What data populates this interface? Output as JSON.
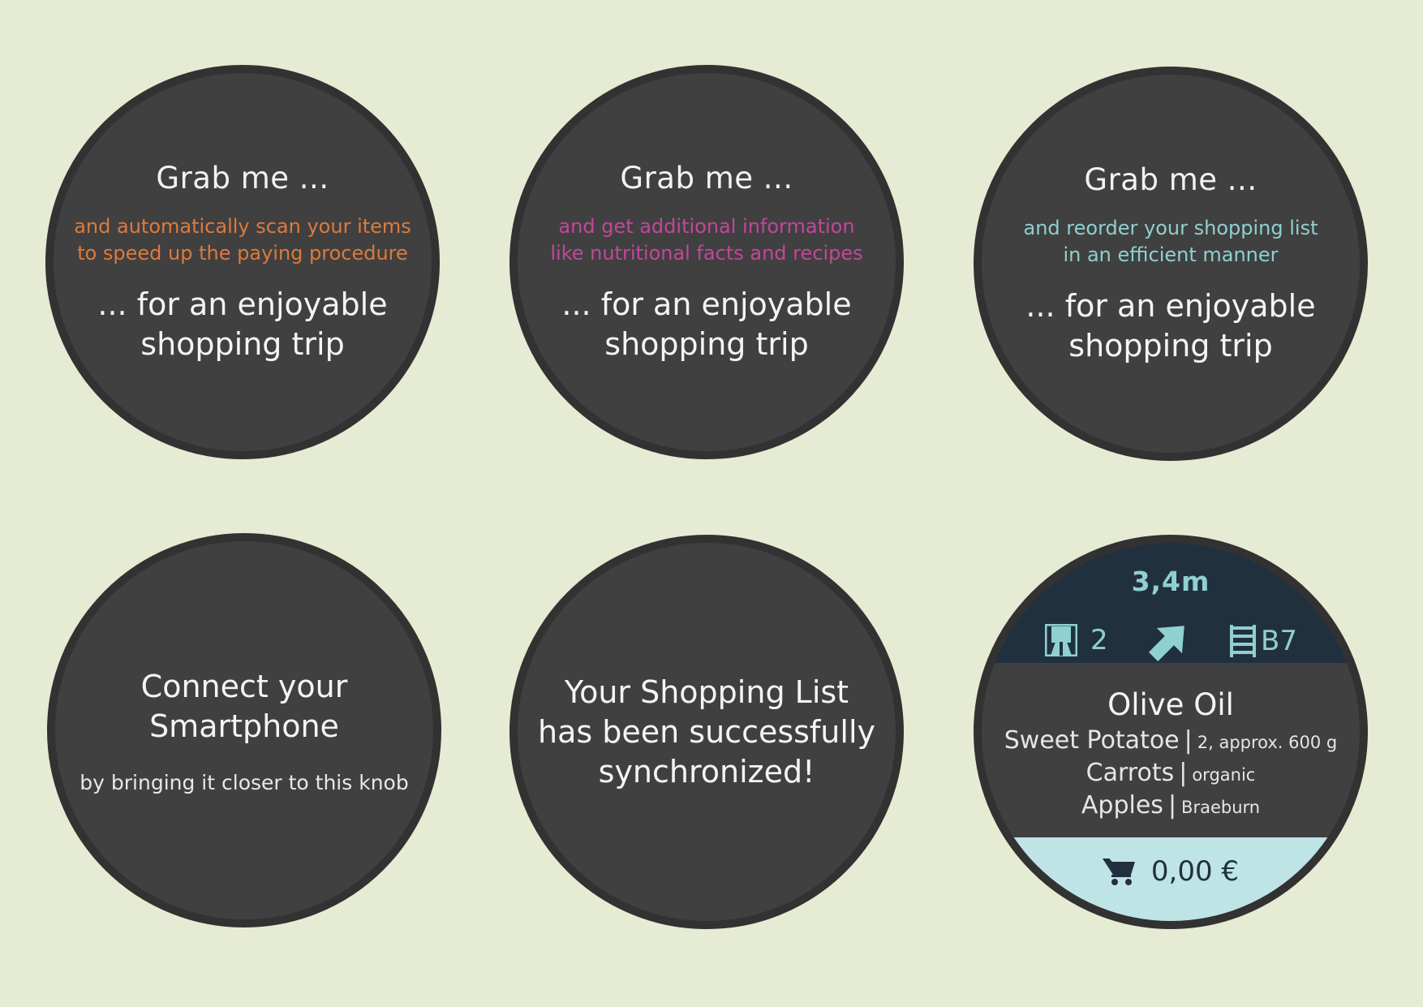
{
  "cards": [
    {
      "title": "Grab me ...",
      "subtitle_line1": "and automatically scan your items",
      "subtitle_line2": "to speed up the paying procedure",
      "tagline_line1": "... for an enjoyable",
      "tagline_line2": "shopping trip",
      "accent": "#dd7a3c"
    },
    {
      "title": "Grab me ...",
      "subtitle_line1": "and get additional information",
      "subtitle_line2": "like nutritional facts and recipes",
      "tagline_line1": "... for an enjoyable",
      "tagline_line2": "shopping trip",
      "accent": "#c2479a"
    },
    {
      "title": "Grab me ...",
      "subtitle_line1": "and reorder your shopping list",
      "subtitle_line2": "in an efficient manner",
      "tagline_line1": "... for an enjoyable",
      "tagline_line2": "shopping trip",
      "accent": "#8fd0d0"
    }
  ],
  "connect": {
    "title_line1": "Connect your",
    "title_line2": "Smartphone",
    "subtitle": "by bringing it closer to this knob"
  },
  "sync": {
    "line1": "Your Shopping List",
    "line2": "has been successfully",
    "line3": "synchronized!"
  },
  "navigation": {
    "distance": "3,4m",
    "aisle_number": "2",
    "shelf_code": "B7",
    "aisle_icon": "aisle-icon",
    "direction_icon": "arrow-up-right-icon",
    "shelf_icon": "shelf-icon",
    "current_item": "Olive Oil",
    "list": [
      {
        "name": "Sweet Potatoe",
        "separator": "|",
        "detail": "2, approx. 600 g"
      },
      {
        "name": "Carrots",
        "separator": "|",
        "detail": "organic"
      },
      {
        "name": "Apples",
        "separator": "|",
        "detail": "Braeburn"
      }
    ],
    "cart_total": "0,00 €",
    "cart_icon": "cart-icon"
  },
  "colors": {
    "background": "#e6ebd3",
    "knob": "#404040",
    "knob_rim": "#323232",
    "nav_header": "#21303f",
    "accent_teal": "#8fd0d0",
    "cart_bar": "#bfe4e6"
  }
}
